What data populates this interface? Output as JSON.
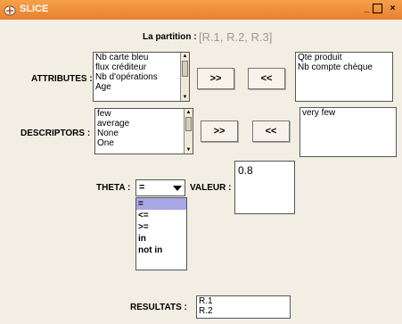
{
  "window": {
    "title": "SLICE"
  },
  "partition": {
    "label": "La partition :",
    "value": "[R.1, R.2, R.3]"
  },
  "attributes": {
    "label": "ATTRIBUTES :",
    "available": [
      "Nb carte bleu",
      "flux créditeur",
      "Nb d'opérations",
      "Age"
    ],
    "selected": [
      "Qte produit",
      "Nb compte chèque"
    ]
  },
  "descriptors": {
    "label": "DESCRIPTORS :",
    "available": [
      "few",
      "average",
      "None",
      "One"
    ],
    "selected": [
      "very few"
    ]
  },
  "buttons": {
    "add": ">>",
    "remove": "<<"
  },
  "theta": {
    "label": "THETA :",
    "selected": "=",
    "options": [
      "=",
      "<=",
      ">=",
      "in",
      "not in"
    ]
  },
  "valeur": {
    "label": "VALEUR :",
    "value": "0.8"
  },
  "resultats": {
    "label": "RESULTATS :",
    "values": [
      "R.1",
      "R.2"
    ]
  },
  "colors": {
    "titlebar": "#e8802e",
    "background": "#f2eee4",
    "selection": "#a8a8e6"
  }
}
